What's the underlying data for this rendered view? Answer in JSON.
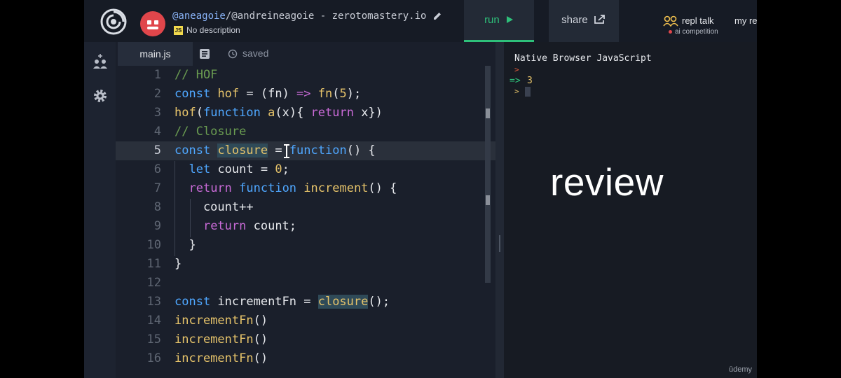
{
  "topbar": {
    "repl_user": "@aneagoie",
    "repl_path": "/@andreineagoie - zerotomastery.io",
    "lang_badge": "JS",
    "description": "No description",
    "run_label": "run",
    "run_icon": "play-icon",
    "share_label": "share",
    "share_icon": "share-icon",
    "talk_title": "repl talk",
    "talk_sub": "ai competition",
    "my_repls": "my re"
  },
  "rail": {
    "items": [
      "add-people-icon",
      "gear-icon"
    ]
  },
  "tabs": {
    "file": "main.js",
    "status": "saved"
  },
  "editor": {
    "line_numbers": [
      "1",
      "2",
      "3",
      "4",
      "5",
      "6",
      "7",
      "8",
      "9",
      "10",
      "11",
      "12",
      "13",
      "14",
      "15",
      "16"
    ],
    "active_line": 5,
    "lines": {
      "l1": "// HOF",
      "l4": "// Closure"
    }
  },
  "console": {
    "header": "Native Browser JavaScript",
    "prompt": ">",
    "result_arrow": "=>",
    "result_value": "3"
  },
  "overlay": {
    "review": "review",
    "watermark": "ūdemy"
  },
  "colors": {
    "run_accent": "#2ec07a",
    "avatar": "#e0464b",
    "keyword": "#4fa7ff",
    "return_kw": "#c86ad6",
    "comment": "#6a9c51"
  }
}
